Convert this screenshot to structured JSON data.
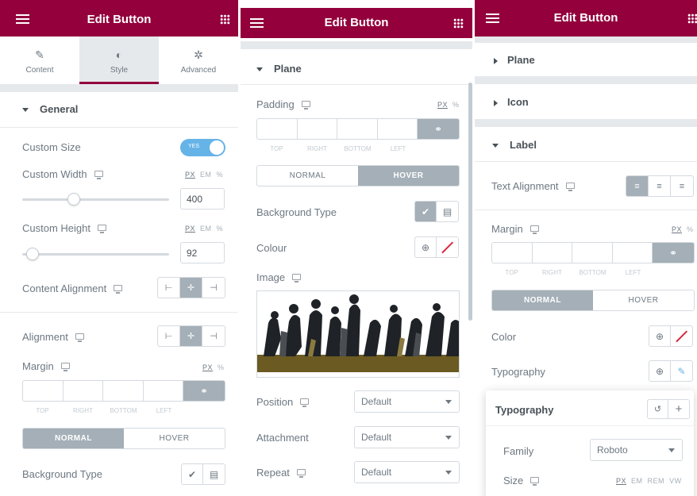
{
  "panel1": {
    "title": "Edit Button",
    "tabs": [
      {
        "label": "Content",
        "icon": "pencil-icon"
      },
      {
        "label": "Style",
        "icon": "half-circle-icon"
      },
      {
        "label": "Advanced",
        "icon": "gear-icon"
      }
    ],
    "section": "General",
    "custom_size": {
      "label": "Custom Size",
      "toggle": "YES"
    },
    "custom_width": {
      "label": "Custom Width",
      "units": [
        "PX",
        "EM",
        "%"
      ],
      "value": "400",
      "slider_fraction": 0.35
    },
    "custom_height": {
      "label": "Custom Height",
      "units": [
        "PX",
        "EM",
        "%"
      ],
      "value": "92",
      "slider_fraction": 0.07
    },
    "content_alignment": {
      "label": "Content Alignment"
    },
    "alignment": {
      "label": "Alignment"
    },
    "margin": {
      "label": "Margin",
      "units": [
        "PX",
        "%"
      ],
      "sides": [
        "TOP",
        "RIGHT",
        "BOTTOM",
        "LEFT"
      ]
    },
    "state_tabs": [
      "NORMAL",
      "HOVER"
    ],
    "background_type": {
      "label": "Background Type"
    }
  },
  "panel2": {
    "title": "Edit Button",
    "section": "Plane",
    "padding": {
      "label": "Padding",
      "units": [
        "PX",
        "%"
      ],
      "sides": [
        "TOP",
        "RIGHT",
        "BOTTOM",
        "LEFT"
      ]
    },
    "state_tabs": [
      "NORMAL",
      "HOVER"
    ],
    "background_type": {
      "label": "Background Type"
    },
    "colour": {
      "label": "Colour"
    },
    "image": {
      "label": "Image"
    },
    "position": {
      "label": "Position",
      "value": "Default"
    },
    "attachment": {
      "label": "Attachment",
      "value": "Default"
    },
    "repeat": {
      "label": "Repeat",
      "value": "Default"
    }
  },
  "panel3": {
    "title": "Edit Button",
    "sections": [
      "Plane",
      "Icon",
      "Label"
    ],
    "text_alignment": {
      "label": "Text Alignment"
    },
    "margin": {
      "label": "Margin",
      "units": [
        "PX",
        "%"
      ],
      "sides": [
        "TOP",
        "RIGHT",
        "BOTTOM",
        "LEFT"
      ]
    },
    "state_tabs": [
      "NORMAL",
      "HOVER"
    ],
    "color": {
      "label": "Color"
    },
    "typography": {
      "label": "Typography"
    },
    "popup": {
      "title": "Typography",
      "family": {
        "label": "Family",
        "value": "Roboto"
      },
      "size": {
        "label": "Size",
        "units": [
          "PX",
          "EM",
          "REM",
          "VW"
        ]
      }
    }
  },
  "colors": {
    "brand": "#93003c",
    "toggle": "#66b3e8",
    "active_gray": "#a4afb7"
  }
}
